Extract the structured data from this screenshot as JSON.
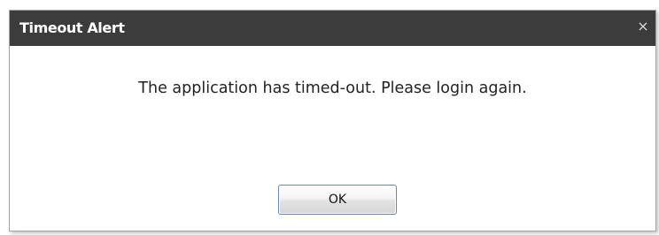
{
  "dialog": {
    "title": "Timeout Alert",
    "close_label": "×",
    "message": "The application has timed-out. Please login again.",
    "ok_label": "OK"
  },
  "colors": {
    "titlebar_bg": "#3c3c3c",
    "titlebar_text": "#ffffff",
    "button_border": "#6b86a8"
  },
  "icons": {
    "close": "close-icon"
  }
}
